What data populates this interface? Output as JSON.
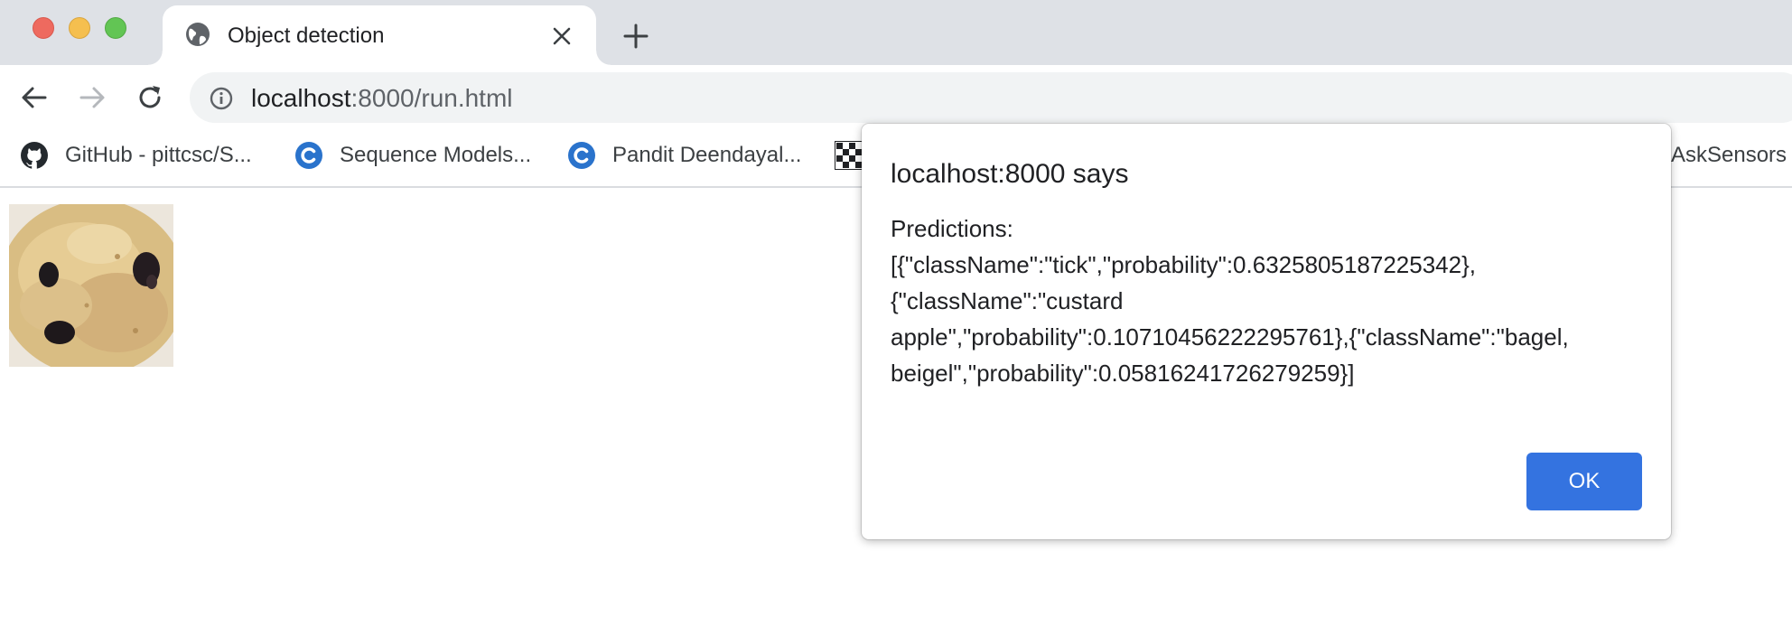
{
  "window": {
    "controls": [
      "close",
      "minimize",
      "zoom"
    ]
  },
  "tab": {
    "title": "Object detection",
    "favicon": "globe-icon"
  },
  "toolbar": {
    "url_host": "localhost",
    "url_path": ":8000/run.html"
  },
  "bookmarks": [
    {
      "label": "GitHub - pittcsc/S...",
      "icon": "github-icon"
    },
    {
      "label": "Sequence Models...",
      "icon": "coursera-icon"
    },
    {
      "label": "Pandit Deendayal...",
      "icon": "coursera-icon"
    },
    {
      "label": "",
      "icon": "checkered-icon"
    },
    {
      "label": "AskSensors",
      "icon": ""
    }
  ],
  "dialog": {
    "title": "localhost:8000 says",
    "message": "Predictions:\n[{\"className\":\"tick\",\"probability\":0.6325805187225342},\n{\"className\":\"custard\napple\",\"probability\":0.10710456222295761},{\"className\":\"bagel,\nbeigel\",\"probability\":0.05816241726279259}]",
    "ok_label": "OK"
  },
  "colors": {
    "tabstrip": "#dee1e6",
    "omnibox": "#f1f3f4",
    "ok_button": "#3473e0",
    "close_light": "#ee6a5f",
    "minimize_light": "#f5bf4f",
    "zoom_light": "#62c554"
  }
}
